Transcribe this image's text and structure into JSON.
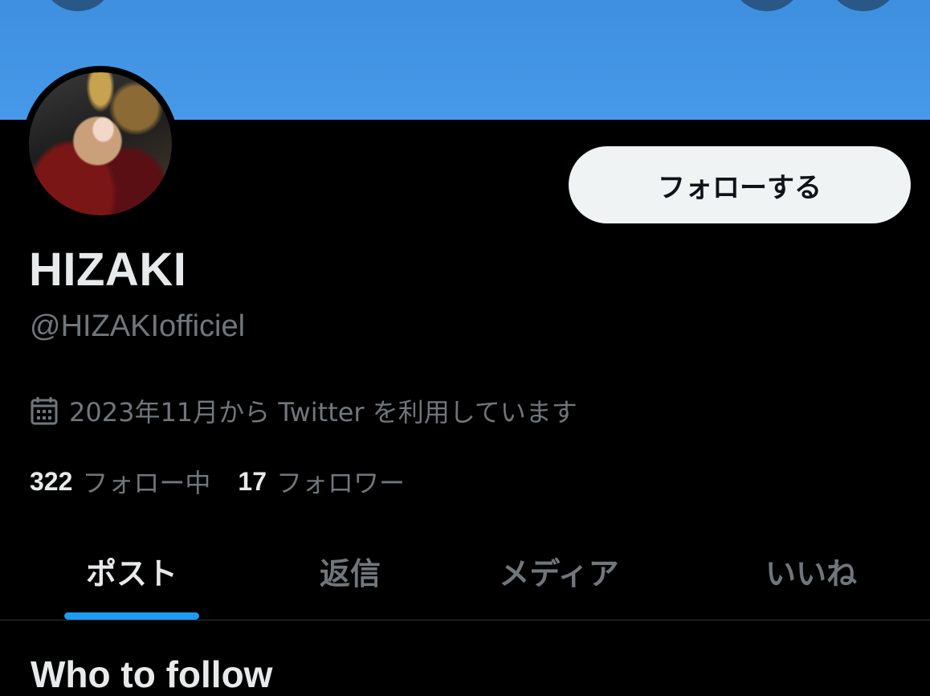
{
  "banner": {
    "color": "#4699e8",
    "buttons": [
      "back-arrow-icon",
      "search-icon",
      "more-icon"
    ]
  },
  "profile": {
    "display_name": "HIZAKI",
    "handle": "@HIZAKIofficiel",
    "joined": "2023年11月から Twitter を利用しています",
    "following_count": "322",
    "following_label": "フォロー中",
    "followers_count": "17",
    "followers_label": "フォロワー"
  },
  "actions": {
    "follow_label": "フォローする"
  },
  "tabs": [
    {
      "label": "ポスト",
      "active": true
    },
    {
      "label": "返信",
      "active": false
    },
    {
      "label": "メディア",
      "active": false
    },
    {
      "label": "いいね",
      "active": false
    }
  ],
  "sections": {
    "who_to_follow": "Who to follow"
  },
  "colors": {
    "background": "#000000",
    "accent": "#1d9bf0",
    "primary_text": "#e7e9ea",
    "secondary_text": "#71767b",
    "follow_button_bg": "#eff3f4"
  }
}
